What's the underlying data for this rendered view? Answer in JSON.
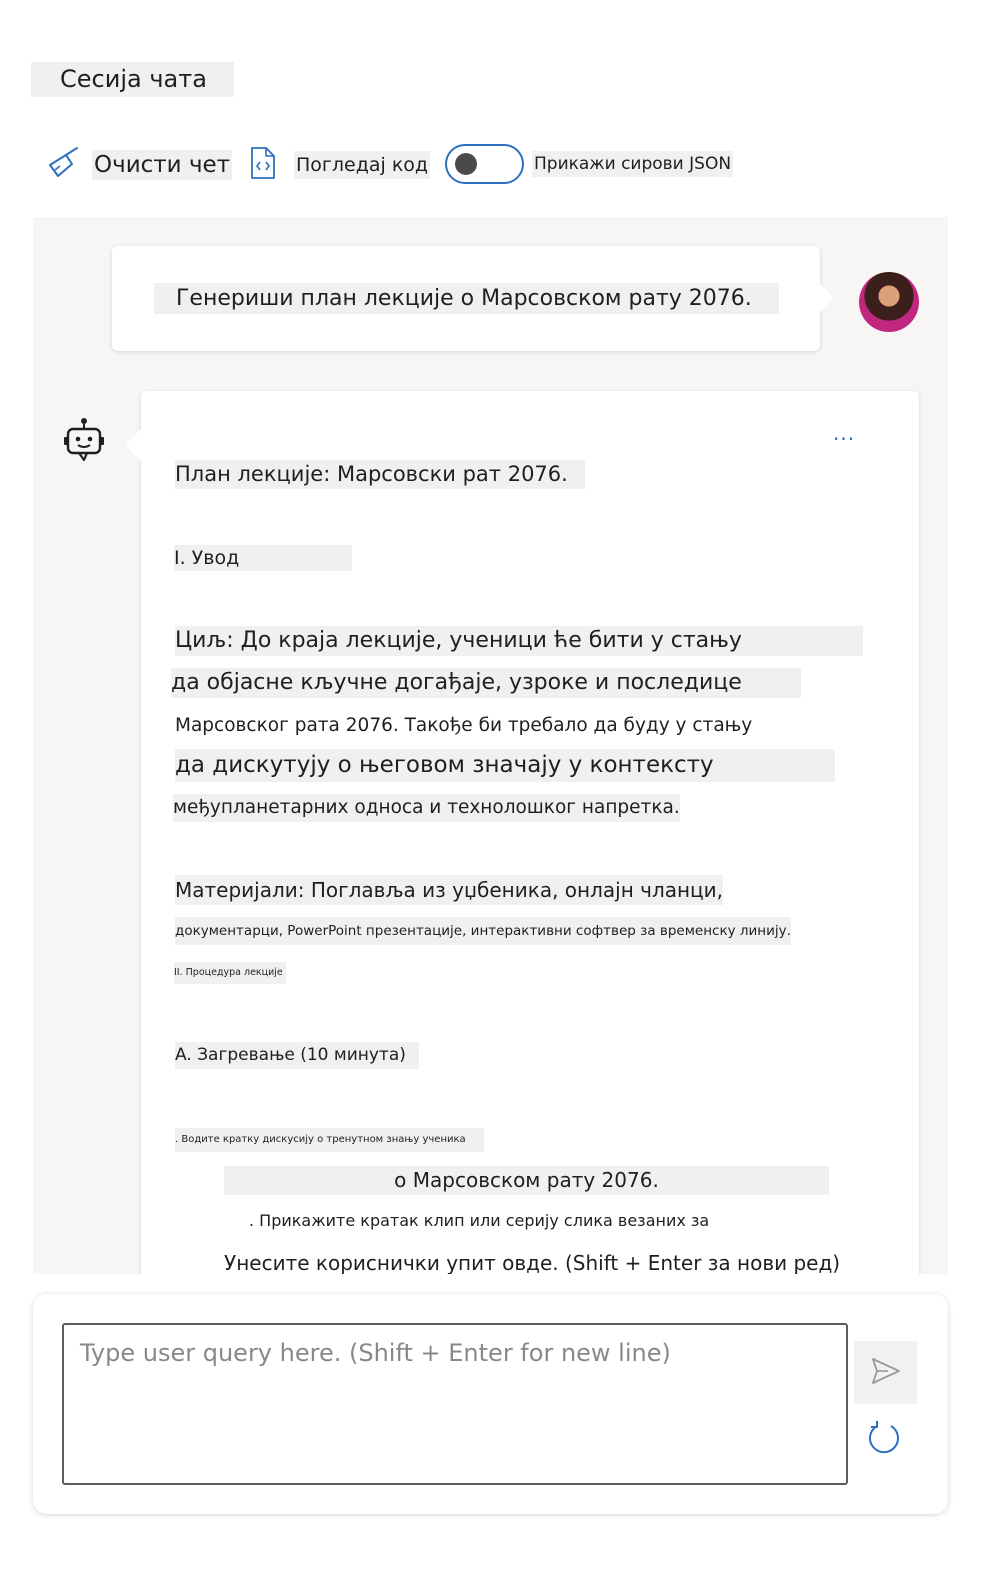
{
  "header": {
    "title": "Сесија чата"
  },
  "toolbar": {
    "clear_label": "Очисти чет",
    "code_label": "Погледај код",
    "json_label": "Прикажи сирови JSON",
    "json_toggle_on": false
  },
  "user_message": {
    "text": "Генериши план лекције о Марсовском рату 2076."
  },
  "assistant_message": {
    "more_label": "...",
    "lines": [
      "План лекције: Марсовски рат 2076.",
      "I. Увод",
      "Циљ: До краја лекције, ученици ће бити у стању",
      "да објасне кључне догађаје, узроке и последице",
      "Марсовског рата 2076. Такође би требало да буду у стању",
      "да дискутују о његовом значају у контексту",
      "међупланетарних односа и технолошког напретка.",
      "Материјали: Поглавља из уџбеника, онлајн чланци,",
      "документарци, PowerPoint презентације, интерактивни софтвер за временску линију.",
      "II. Процедура лекције",
      "A. Загревање (10 минута)",
      ". Водите кратку дискусију о тренутном знању ученика",
      "о Марсовском рату 2076.",
      ". Прикажите кратак клип или серију слика везаних за",
      "Унесите кориснички упит овде. (Shift + Enter за нови ред)"
    ]
  },
  "input": {
    "placeholder": "Type user query here. (Shift + Enter for new line)"
  },
  "icons": {
    "clear": "broom-icon",
    "code": "code-file-icon",
    "bot": "bot-icon",
    "send": "send-icon",
    "refresh": "refresh-icon"
  },
  "colors": {
    "accent": "#2f6fbf",
    "panel": "#f7f6f5",
    "highlight": "#f0f0f0"
  }
}
